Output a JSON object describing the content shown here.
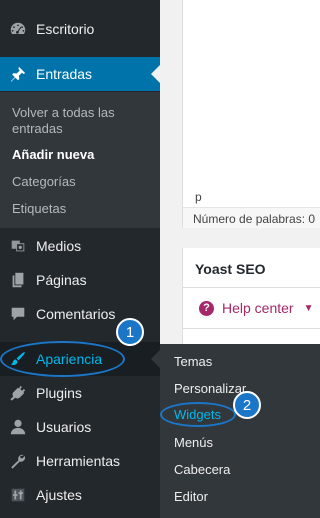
{
  "sidebar": {
    "items": [
      {
        "label": "Escritorio",
        "icon": "dashboard-icon"
      },
      {
        "label": "Entradas",
        "icon": "pin-icon"
      },
      {
        "label": "Medios",
        "icon": "media-icon"
      },
      {
        "label": "Páginas",
        "icon": "pages-icon"
      },
      {
        "label": "Comentarios",
        "icon": "comments-icon"
      },
      {
        "label": "Apariencia",
        "icon": "brush-icon"
      },
      {
        "label": "Plugins",
        "icon": "plug-icon"
      },
      {
        "label": "Usuarios",
        "icon": "users-icon"
      },
      {
        "label": "Herramientas",
        "icon": "wrench-icon"
      },
      {
        "label": "Ajustes",
        "icon": "settings-icon"
      }
    ],
    "submenu": [
      "Volver a todas las entradas",
      "Añadir nueva",
      "Categorías",
      "Etiquetas"
    ]
  },
  "editor": {
    "path": "p",
    "word_count": "Número de palabras: 0"
  },
  "yoast": {
    "title": "Yoast SEO",
    "help_center": "Help center",
    "help_icon_glyph": "?",
    "chevron_glyph": "▼"
  },
  "flyout": [
    "Temas",
    "Personalizar",
    "Widgets",
    "Menús",
    "Cabecera",
    "Editor"
  ],
  "annotations": [
    "1",
    "2"
  ],
  "colors": {
    "sidebar_bg": "#23282d",
    "submenu_bg": "#32373c",
    "accent": "#0073aa",
    "highlight": "#00b9eb",
    "annotation": "#1b76c8",
    "yoast": "#a4286a"
  }
}
